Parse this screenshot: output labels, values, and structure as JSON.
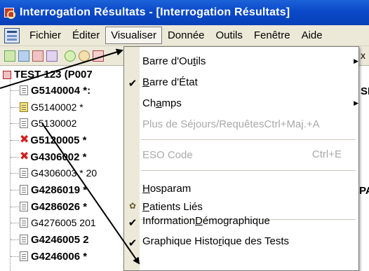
{
  "window": {
    "title": "Interrogation Résultats - [Interrogation Résultats]"
  },
  "menubar": {
    "items": [
      "Fichier",
      "Éditer",
      "Visualiser",
      "Donnée",
      "Outils",
      "Fenêtre",
      "Aide"
    ],
    "active": "Visualiser"
  },
  "tree": {
    "root_label": "TEST 123 (P007",
    "rows": [
      {
        "label": "G5140004 *",
        "suffix": " :",
        "style": "bold",
        "icon": "document-icon"
      },
      {
        "label": "G5140002 *",
        "suffix": "",
        "style": "normal",
        "icon": "document-yellow-icon"
      },
      {
        "label": "G5130002",
        "suffix": "",
        "style": "normal",
        "icon": "document-icon"
      },
      {
        "label": "G5120005 *",
        "suffix": "",
        "style": "bold",
        "icon": "red-x-icon"
      },
      {
        "label": "G4306002 *",
        "suffix": "",
        "style": "bold",
        "icon": "red-x-icon"
      },
      {
        "label": "G4306003 * 20",
        "suffix": "",
        "style": "normal",
        "icon": "document-icon"
      },
      {
        "label": "G4286019 *",
        "suffix": "",
        "style": "bold",
        "icon": "document-icon"
      },
      {
        "label": "G4286026 *",
        "suffix": "",
        "style": "bold",
        "icon": "document-icon"
      },
      {
        "label": "G4276005  201",
        "suffix": "",
        "style": "normal",
        "icon": "document-icon"
      },
      {
        "label": "G4246005  2",
        "suffix": "",
        "style": "bold",
        "icon": "document-icon"
      },
      {
        "label": "G4246006 *",
        "suffix": "",
        "style": "bold",
        "icon": "document-icon"
      }
    ],
    "right_fragments": [
      "SI",
      "PA"
    ]
  },
  "view_menu": {
    "items": [
      {
        "label_pre": "Barre d'Ou",
        "label_u": "t",
        "label_post": "ils",
        "checked": false,
        "submenu": true,
        "disabled": false,
        "shortcut": ""
      },
      {
        "label_pre": "",
        "label_u": "B",
        "label_post": "arre d'État",
        "checked": true,
        "submenu": false,
        "disabled": false,
        "shortcut": ""
      },
      {
        "label_pre": "Ch",
        "label_u": "a",
        "label_post": "mps",
        "checked": false,
        "submenu": true,
        "disabled": false,
        "shortcut": ""
      },
      {
        "label_pre": "Plus de Séjours/Requêtes",
        "label_u": "",
        "label_post": "",
        "checked": false,
        "submenu": false,
        "disabled": true,
        "shortcut": "Ctrl+Maj.+A"
      },
      {
        "label_pre": "ESO Code",
        "label_u": "",
        "label_post": "",
        "checked": false,
        "submenu": false,
        "disabled": true,
        "shortcut": "Ctrl+E"
      },
      {
        "label_pre": "",
        "label_u": "H",
        "label_post": "osparam",
        "checked": false,
        "submenu": false,
        "disabled": false,
        "shortcut": ""
      },
      {
        "label_pre": "",
        "label_u": "P",
        "label_post": "atients Liés",
        "checked": false,
        "submenu": false,
        "disabled": false,
        "shortcut": "",
        "icon": "patients-icon"
      },
      {
        "label_pre": "Information ",
        "label_u": "D",
        "label_post": "émographique",
        "checked": true,
        "submenu": false,
        "disabled": false,
        "shortcut": ""
      },
      {
        "label_pre": "Graphique Histo",
        "label_u": "r",
        "label_post": "ique des Tests",
        "checked": true,
        "submenu": false,
        "disabled": false,
        "shortcut": ""
      }
    ]
  },
  "toolbar": {
    "overflow_label": "x"
  },
  "colors": {
    "titlebar": "#0a49c9",
    "menubar": "#ece9d8",
    "disabled_text": "#a9a9a9",
    "error_x": "#d21f1f"
  }
}
